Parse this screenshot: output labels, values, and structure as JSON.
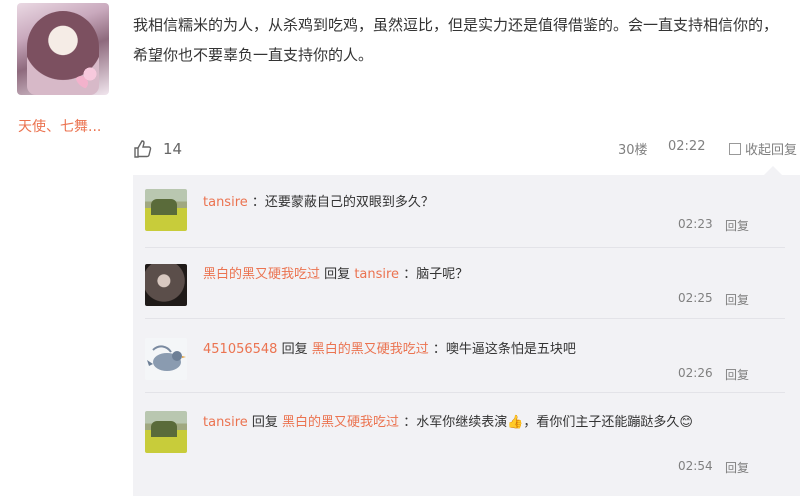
{
  "post": {
    "username": "天使、七舞...",
    "text": "我相信糯米的为人，从杀鸡到吃鸡，虽然逗比，但是实力还是值得借鉴的。会一直支持相信你的，希望你也不要辜负一直支持你的人。",
    "likes": "14",
    "floor": "30楼",
    "time": "02:22",
    "fav_label": "收起回复"
  },
  "replies": [
    {
      "user": "tansire",
      "reply_word": "",
      "target": "",
      "text": "：还要蒙蔽自己的双眼到多久？",
      "time": "02:23",
      "reply_label": "回复"
    },
    {
      "user": "黑白的黑又硬我吃过",
      "reply_word": "回复",
      "target": "tansire",
      "text": "：脑子呢？",
      "time": "02:25",
      "reply_label": "回复"
    },
    {
      "user": "451056548",
      "reply_word": "回复",
      "target": "黑白的黑又硬我吃过",
      "text": "：噢牛逼这条怕是五块吧",
      "time": "02:26",
      "reply_label": "回复"
    },
    {
      "user": "tansire",
      "reply_word": "回复",
      "target": "黑白的黑又硬我吃过",
      "text": "：水军你继续表演👍，看你们主子还能蹦跶多久😊",
      "time": "02:54",
      "reply_label": "回复"
    }
  ],
  "icons": {
    "like": "thumbs-up-icon"
  },
  "colors": {
    "username": "#eb7350",
    "meta": "#808080",
    "reply_bg": "#f2f2f5"
  }
}
